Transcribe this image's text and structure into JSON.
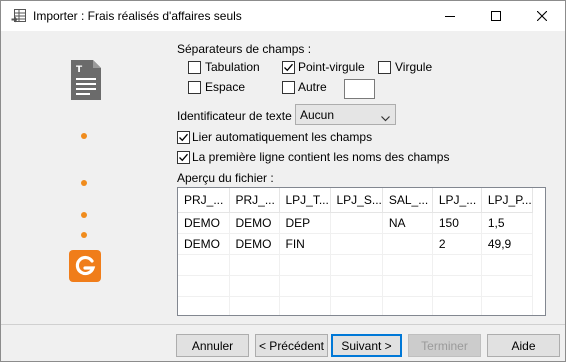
{
  "window": {
    "title": "Importer : Frais réalisés d'affaires seuls",
    "controls": [
      "minimize-icon",
      "maximize-icon",
      "close-icon"
    ]
  },
  "colors": {
    "accent": "#f07d1a",
    "dot": "#f08c1e",
    "focus": "#0078d7"
  },
  "separators": {
    "heading": "Séparateurs de champs :",
    "tabulation": {
      "label": "Tabulation",
      "checked": false
    },
    "point_virgule": {
      "label": "Point-virgule",
      "checked": true
    },
    "virgule": {
      "label": "Virgule",
      "checked": false
    },
    "espace": {
      "label": "Espace",
      "checked": false
    },
    "autre": {
      "label": "Autre",
      "checked": false,
      "value": ""
    }
  },
  "text_identifier": {
    "label": "Identificateur de texte",
    "value": "Aucun"
  },
  "options": {
    "auto_link": {
      "label": "Lier automatiquement les champs",
      "checked": true
    },
    "first_line_names": {
      "label": "La première ligne contient les noms des champs",
      "checked": true
    }
  },
  "preview": {
    "heading": "Aperçu du fichier :",
    "columns": [
      "PRJ_...",
      "PRJ_...",
      "LPJ_T...",
      "LPJ_S...",
      "SAL_...",
      "LPJ_...",
      "LPJ_P..."
    ],
    "rows": [
      [
        "DEMO",
        "DEMO",
        "DEP",
        "",
        "NA",
        "150",
        "1,5"
      ],
      [
        "DEMO",
        "DEMO",
        "FIN",
        "",
        "",
        "2",
        "49,9"
      ]
    ]
  },
  "buttons": {
    "annuler": "Annuler",
    "precedent": "< Précédent",
    "suivant": "Suivant >",
    "terminer": "Terminer",
    "aide": "Aide"
  }
}
